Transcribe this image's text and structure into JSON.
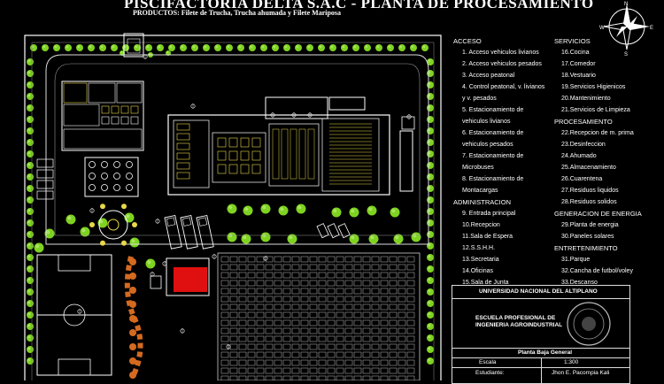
{
  "title": "PISCIFACTORIA DELTA S.A.C - PLANTA DE PROCESAMIENTO",
  "subtitle": "PRODUCTOS: Filete de Trucha, Trucha ahumada y Filete Mariposa",
  "compass": {
    "north": "N",
    "south": "S",
    "west": "W",
    "east": "E"
  },
  "legend": {
    "acceso": {
      "heading": "ACCESO",
      "items": [
        "1.   Acceso vehiculos livianos",
        "2.   Acceso vehiculos pesados",
        "3.   Acceso peatonal",
        "4.   Control peatonal, v. livianos",
        "y v. pesados",
        "5.   Estacionamiento de",
        "vehiculos livianos",
        "6.   Estacionamiento de",
        "vehiculos pesados",
        "7.   Estacionamiento de",
        "Microbuses",
        "8.   Estacionamiento de",
        "Montacargas"
      ]
    },
    "administracion": {
      "heading": "ADMINISTRACION",
      "items": [
        "9.   Entrada principal",
        "10.Recepcion",
        "11.Sala de Espera",
        "12.S.S.H.H.",
        "13.Secretaria",
        "14.Oficinas",
        "15.Sala de Junta"
      ]
    },
    "servicios": {
      "heading": "SERVICIOS",
      "items": [
        "16.Cocina",
        "17.Comedor",
        "18.Vestuario",
        "19.Servicios Higienicos",
        "20.Mantenimiento",
        "21.Servicios de Limpieza"
      ]
    },
    "procesamiento": {
      "heading": "PROCESAMIENTO",
      "items": [
        "22.Recepcion de m. prima",
        "23.Desinfeccion",
        "24.Ahumado",
        "25.Almacenamiento",
        "26.Cuarentena",
        "27.Residuos liquidos",
        "28.Residuos solidos"
      ]
    },
    "energia": {
      "heading": "GENERACION DE ENERGIA",
      "items": [
        "29.Planta de energia",
        "30.Paneles solares"
      ]
    },
    "entretenimiento": {
      "heading": "ENTRETENIMIENTO",
      "items": [
        "31.Parque",
        "32.Cancha de futbol/voley",
        "33.Descanso"
      ]
    }
  },
  "title_block": {
    "university": "UNIVERSIDAD NACIONAL DEL ALTIPLANO",
    "school_line1": "ESCUELA PROFESIONAL DE",
    "school_line2": "INGENIERIA AGROINDUSTRIAL",
    "sheet": "Planta Baja General",
    "scale_label": "Escala",
    "scale_value": "1:300",
    "student_label": "Estudiante:",
    "student_value": "Jhon E. Pacompia Kali"
  },
  "colors": {
    "background": "#000000",
    "walls": "#ffffff",
    "trees": "#7ed321",
    "tree_light": "#c8f08a",
    "hatch_red": "#e01010",
    "fixtures_yellow": "#e8d84a",
    "path_orange": "#d46a20",
    "grid": "#bfbfbf"
  }
}
